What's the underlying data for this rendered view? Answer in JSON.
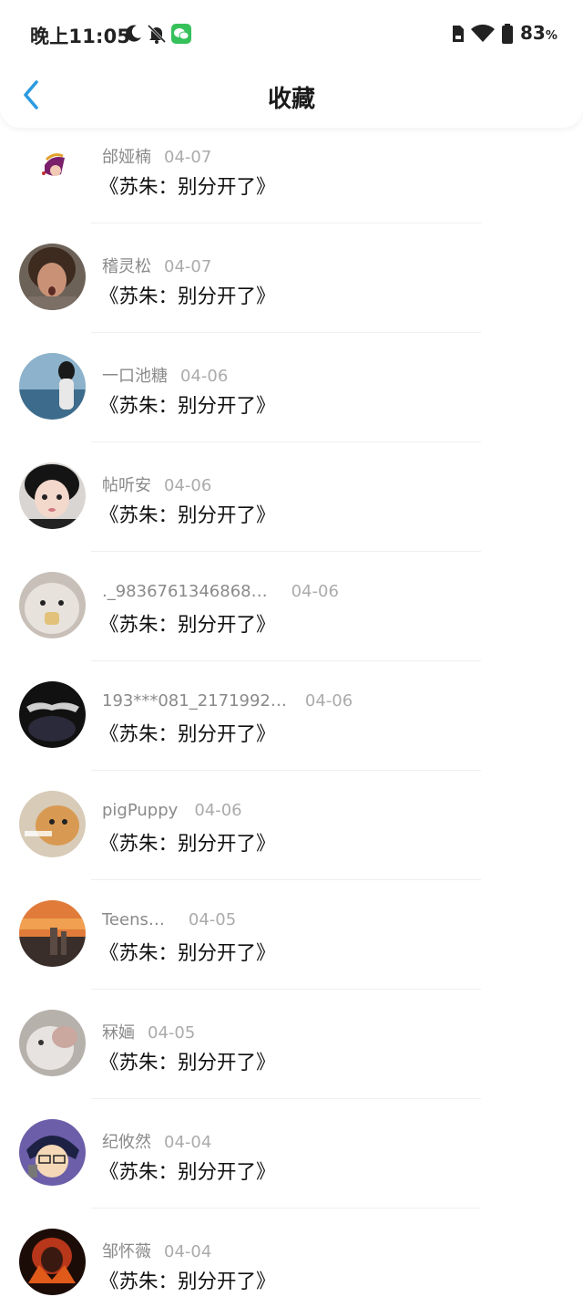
{
  "status_bar": {
    "time": "晚上11:05",
    "battery_percent": "83",
    "battery_unit": "%"
  },
  "nav": {
    "title": "收藏"
  },
  "items": [
    {
      "user": "邰娅楠",
      "date": "04-07",
      "book": "《苏朱：别分开了》"
    },
    {
      "user": "稽灵松",
      "date": "04-07",
      "book": "《苏朱：别分开了》"
    },
    {
      "user": "一口池糖",
      "date": "04-06",
      "book": "《苏朱：别分开了》"
    },
    {
      "user": "帖听安",
      "date": "04-06",
      "book": "《苏朱：别分开了》"
    },
    {
      "user": "._9836761346868…",
      "date": "04-06",
      "book": "《苏朱：别分开了》"
    },
    {
      "user": "193***081_2171992…",
      "date": "04-06",
      "book": "《苏朱：别分开了》"
    },
    {
      "user": "pigPuppy",
      "date": "04-06",
      "book": "《苏朱：别分开了》"
    },
    {
      "user": "Teens…",
      "date": "04-05",
      "book": "《苏朱：别分开了》"
    },
    {
      "user": "冧婳",
      "date": "04-05",
      "book": "《苏朱：别分开了》"
    },
    {
      "user": "纪攸然",
      "date": "04-04",
      "book": "《苏朱：别分开了》"
    },
    {
      "user": "邹怀薇",
      "date": "04-04",
      "book": "《苏朱：别分开了》"
    }
  ],
  "colors": {
    "accent": "#2b9be0",
    "wechat": "#36c15a"
  }
}
